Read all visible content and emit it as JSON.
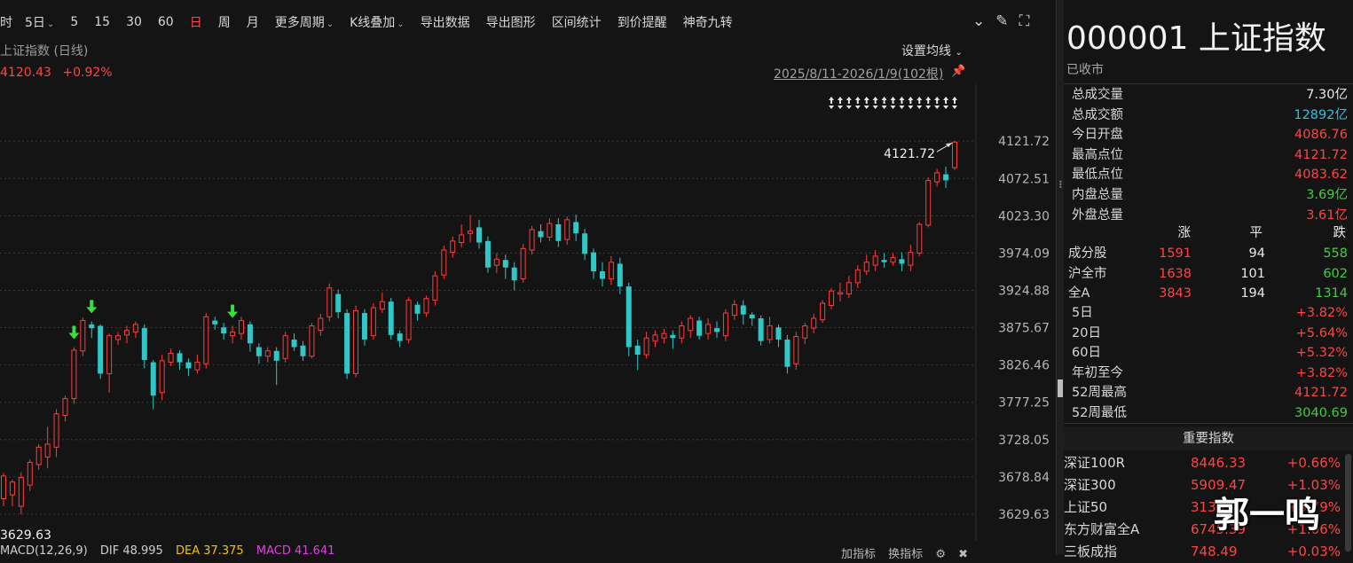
{
  "toolbar": {
    "items": [
      {
        "label": "分时",
        "active": false,
        "dropdown": false
      },
      {
        "label": "5日",
        "active": false,
        "dropdown": true
      },
      {
        "label": "5",
        "active": false,
        "dropdown": false
      },
      {
        "label": "15",
        "active": false,
        "dropdown": false
      },
      {
        "label": "30",
        "active": false,
        "dropdown": false
      },
      {
        "label": "60",
        "active": false,
        "dropdown": false
      },
      {
        "label": "日",
        "active": true,
        "dropdown": false
      },
      {
        "label": "周",
        "active": false,
        "dropdown": false
      },
      {
        "label": "月",
        "active": false,
        "dropdown": false
      },
      {
        "label": "更多周期",
        "active": false,
        "dropdown": true
      },
      {
        "label": "K线叠加",
        "active": false,
        "dropdown": true
      },
      {
        "label": "导出数据",
        "active": false,
        "dropdown": false
      },
      {
        "label": "导出图形",
        "active": false,
        "dropdown": false
      },
      {
        "label": "区间统计",
        "active": false,
        "dropdown": false
      },
      {
        "label": "到价提醒",
        "active": false,
        "dropdown": false
      },
      {
        "label": "神奇九转",
        "active": false,
        "dropdown": false
      }
    ],
    "icons": [
      "chevron-down-circle-icon",
      "brush-icon",
      "fullscreen-icon"
    ]
  },
  "chart_header": {
    "name": "上证指数 (日线)",
    "price": "4120.43",
    "change": "+0.92%",
    "ma_setting": "设置均线",
    "range": "2025/8/11-2026/1/9(102根)"
  },
  "chart_data": {
    "type": "candlestick",
    "ylim": [
      3612,
      4150
    ],
    "y_ticks": [
      "4121.72",
      "4072.51",
      "4023.30",
      "3974.09",
      "3924.88",
      "3875.67",
      "3826.46",
      "3777.25",
      "3728.05",
      "3678.84",
      "3629.63"
    ],
    "max_label": "4121.72",
    "min_label": "3629.63",
    "colors": {
      "up": "#ff3c3c",
      "down": "#2ec8c8",
      "grid": "#3a3a3a"
    },
    "candles": [
      [
        3650,
        3680,
        3640,
        3684
      ],
      [
        3655,
        3672,
        3640,
        3675
      ],
      [
        3640,
        3678,
        3629.63,
        3685
      ],
      [
        3668,
        3698,
        3660,
        3702
      ],
      [
        3695,
        3718,
        3688,
        3722
      ],
      [
        3705,
        3722,
        3690,
        3745
      ],
      [
        3718,
        3762,
        3705,
        3768
      ],
      [
        3760,
        3782,
        3752,
        3786
      ],
      [
        3782,
        3846,
        3775,
        3850
      ],
      [
        3845,
        3885,
        3838,
        3889
      ],
      [
        3880,
        3875,
        3862,
        3884
      ],
      [
        3878,
        3815,
        3808,
        3880
      ],
      [
        3815,
        3865,
        3790,
        3868
      ],
      [
        3860,
        3865,
        3853,
        3870
      ],
      [
        3866,
        3872,
        3855,
        3878
      ],
      [
        3870,
        3880,
        3862,
        3884
      ],
      [
        3875,
        3833,
        3822,
        3880
      ],
      [
        3830,
        3786,
        3768,
        3833
      ],
      [
        3790,
        3832,
        3780,
        3840
      ],
      [
        3830,
        3842,
        3825,
        3848
      ],
      [
        3842,
        3830,
        3820,
        3846
      ],
      [
        3830,
        3822,
        3812,
        3835
      ],
      [
        3820,
        3830,
        3815,
        3840
      ],
      [
        3828,
        3890,
        3822,
        3895
      ],
      [
        3885,
        3880,
        3873,
        3890
      ],
      [
        3876,
        3868,
        3860,
        3882
      ],
      [
        3865,
        3870,
        3855,
        3878
      ],
      [
        3868,
        3885,
        3860,
        3890
      ],
      [
        3880,
        3855,
        3844,
        3884
      ],
      [
        3850,
        3838,
        3828,
        3855
      ],
      [
        3838,
        3845,
        3830,
        3850
      ],
      [
        3845,
        3832,
        3800,
        3850
      ],
      [
        3835,
        3865,
        3830,
        3870
      ],
      [
        3860,
        3850,
        3845,
        3868
      ],
      [
        3852,
        3838,
        3832,
        3858
      ],
      [
        3838,
        3878,
        3835,
        3882
      ],
      [
        3872,
        3888,
        3865,
        3894
      ],
      [
        3890,
        3928,
        3884,
        3934
      ],
      [
        3920,
        3896,
        3888,
        3926
      ],
      [
        3895,
        3815,
        3808,
        3900
      ],
      [
        3815,
        3898,
        3810,
        3905
      ],
      [
        3895,
        3860,
        3852,
        3900
      ],
      [
        3865,
        3902,
        3860,
        3908
      ],
      [
        3900,
        3910,
        3895,
        3922
      ],
      [
        3910,
        3866,
        3860,
        3915
      ],
      [
        3868,
        3858,
        3850,
        3872
      ],
      [
        3860,
        3912,
        3855,
        3916
      ],
      [
        3906,
        3894,
        3885,
        3910
      ],
      [
        3895,
        3914,
        3890,
        3918
      ],
      [
        3912,
        3944,
        3905,
        3950
      ],
      [
        3945,
        3978,
        3940,
        3984
      ],
      [
        3975,
        3990,
        3968,
        3996
      ],
      [
        3988,
        3998,
        3982,
        4012
      ],
      [
        4000,
        4003,
        3988,
        4024
      ],
      [
        4008,
        3988,
        3980,
        4018
      ],
      [
        3990,
        3955,
        3948,
        3996
      ],
      [
        3958,
        3966,
        3948,
        3974
      ],
      [
        3965,
        3955,
        3940,
        3972
      ],
      [
        3955,
        3938,
        3925,
        3962
      ],
      [
        3940,
        3980,
        3935,
        3986
      ],
      [
        3978,
        4005,
        3972,
        4010
      ],
      [
        4003,
        3995,
        3988,
        4012
      ],
      [
        3995,
        4013,
        3990,
        4020
      ],
      [
        4012,
        3990,
        3982,
        4020
      ],
      [
        3992,
        4018,
        3985,
        4022
      ],
      [
        4015,
        4000,
        3990,
        4025
      ],
      [
        4000,
        3973,
        3965,
        4006
      ],
      [
        3975,
        3950,
        3940,
        3980
      ],
      [
        3950,
        3940,
        3930,
        3962
      ],
      [
        3940,
        3962,
        3932,
        3970
      ],
      [
        3960,
        3930,
        3920,
        3968
      ],
      [
        3930,
        3850,
        3838,
        3935
      ],
      [
        3852,
        3840,
        3820,
        3860
      ],
      [
        3840,
        3862,
        3835,
        3870
      ],
      [
        3858,
        3866,
        3850,
        3872
      ],
      [
        3862,
        3868,
        3855,
        3874
      ],
      [
        3866,
        3862,
        3848,
        3872
      ],
      [
        3862,
        3878,
        3855,
        3884
      ],
      [
        3872,
        3888,
        3862,
        3892
      ],
      [
        3885,
        3865,
        3860,
        3890
      ],
      [
        3868,
        3880,
        3860,
        3888
      ],
      [
        3875,
        3870,
        3862,
        3884
      ],
      [
        3865,
        3895,
        3858,
        3900
      ],
      [
        3892,
        3906,
        3886,
        3912
      ],
      [
        3905,
        3893,
        3880,
        3912
      ],
      [
        3893,
        3888,
        3878,
        3896
      ],
      [
        3888,
        3858,
        3852,
        3892
      ],
      [
        3860,
        3878,
        3855,
        3890
      ],
      [
        3876,
        3860,
        3850,
        3880
      ],
      [
        3860,
        3824,
        3815,
        3866
      ],
      [
        3828,
        3864,
        3820,
        3870
      ],
      [
        3862,
        3878,
        3854,
        3882
      ],
      [
        3875,
        3888,
        3868,
        3894
      ],
      [
        3886,
        3908,
        3882,
        3912
      ],
      [
        3905,
        3924,
        3900,
        3928
      ],
      [
        3920,
        3922,
        3910,
        3935
      ],
      [
        3920,
        3935,
        3915,
        3944
      ],
      [
        3935,
        3952,
        3928,
        3958
      ],
      [
        3950,
        3962,
        3945,
        3972
      ],
      [
        3958,
        3970,
        3950,
        3978
      ],
      [
        3965,
        3962,
        3955,
        3974
      ],
      [
        3962,
        3968,
        3958,
        3974
      ],
      [
        3966,
        3960,
        3950,
        3975
      ],
      [
        3958,
        3975,
        3950,
        3985
      ],
      [
        3974,
        4012,
        3970,
        4015
      ],
      [
        4011,
        4070,
        4008,
        4074
      ],
      [
        4068,
        4080,
        4062,
        4085
      ],
      [
        4078,
        4070,
        4060,
        4088
      ],
      [
        4086.76,
        4120.43,
        4083.62,
        4121.72
      ]
    ]
  },
  "macd": {
    "name": "MACD(12,26,9)",
    "dif": "DIF 48.995",
    "dea": "DEA 37.375",
    "macd": "MACD 41.641",
    "add": "加指标",
    "swap": "换指标"
  },
  "panel": {
    "code": "000001",
    "name": "上证指数",
    "status": "已收市",
    "stats": [
      {
        "label": "总成交量",
        "value": "7.30亿",
        "color": "white"
      },
      {
        "label": "总成交额",
        "value": "12892亿",
        "color": "cyan"
      },
      {
        "label": "今日开盘",
        "value": "4086.76",
        "color": "red"
      },
      {
        "label": "最高点位",
        "value": "4121.72",
        "color": "red"
      },
      {
        "label": "最低点位",
        "value": "4083.62",
        "color": "red"
      },
      {
        "label": "内盘总量",
        "value": "3.69亿",
        "color": "green"
      },
      {
        "label": "外盘总量",
        "value": "3.61亿",
        "color": "red"
      }
    ],
    "breadth_header": [
      "涨",
      "平",
      "跌"
    ],
    "breadth": [
      {
        "label": "成分股",
        "up": "1591",
        "flat": "94",
        "down": "558"
      },
      {
        "label": "沪全市",
        "up": "1638",
        "flat": "101",
        "down": "602"
      },
      {
        "label": "全A",
        "up": "3843",
        "flat": "194",
        "down": "1314"
      }
    ],
    "periods": [
      {
        "label": "5日",
        "value": "+3.82%",
        "color": "red"
      },
      {
        "label": "20日",
        "value": "+5.64%",
        "color": "red"
      },
      {
        "label": "60日",
        "value": "+5.32%",
        "color": "red"
      },
      {
        "label": "年初至今",
        "value": "+3.82%",
        "color": "red"
      },
      {
        "label": "52周最高",
        "value": "4121.72",
        "color": "red"
      },
      {
        "label": "52周最低",
        "value": "3040.69",
        "color": "green"
      }
    ],
    "indices_title": "重要指数",
    "indices": [
      {
        "name": "深证100R",
        "price": "8446.33",
        "change": "+0.66%"
      },
      {
        "name": "深证300",
        "price": "5909.47",
        "change": "+1.03%"
      },
      {
        "name": "上证50",
        "price": "3138",
        "change": "+0.79%"
      },
      {
        "name": "东方财富全A",
        "price": "6745.39",
        "change": "+1.06%"
      },
      {
        "name": "三板成指",
        "price": "748.49",
        "change": "+0.03%"
      }
    ]
  },
  "watermark": "郭一鸣"
}
